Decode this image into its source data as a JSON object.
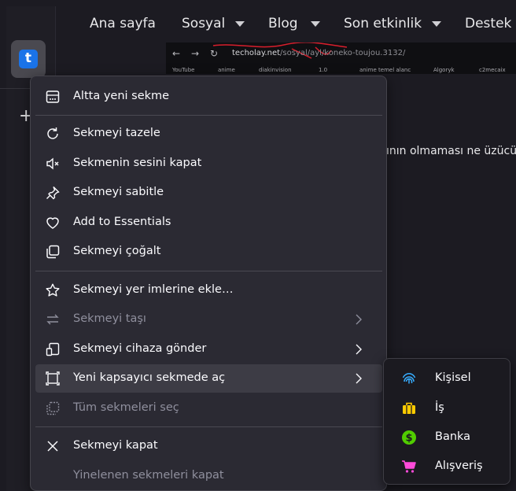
{
  "site_nav": {
    "items": [
      {
        "label": "Ana sayfa"
      },
      {
        "label": "Sosyal"
      },
      {
        "label": "Blog"
      },
      {
        "label": "Son etkinlik"
      },
      {
        "label": "Destek"
      }
    ]
  },
  "embedded_shot": {
    "url_host": "techolay.net",
    "url_path": "/sosyal/ayl/koneko-toujou.3132/",
    "bookmarks": [
      "YouTube",
      "anime",
      "diakinvision",
      "1.0",
      "anime temel alanc",
      "Algoryk",
      "c2mecaix"
    ]
  },
  "page_text": "ının olmaması ne üzücü.",
  "sidebar": {
    "tab_icon_letter": "t",
    "new_tab_glyph": "+"
  },
  "context_menu": {
    "items": [
      {
        "label": "Altta yeni sekme",
        "icon": "new-tab-below-icon",
        "disabled": false
      },
      {
        "label": "Sekmeyi tazele",
        "icon": "reload-icon",
        "disabled": false
      },
      {
        "label": "Sekmenin sesini kapat",
        "icon": "mute-icon",
        "disabled": false
      },
      {
        "label": "Sekmeyi sabitle",
        "icon": "pin-icon",
        "disabled": false
      },
      {
        "label": "Add to Essentials",
        "icon": "heart-icon",
        "disabled": false
      },
      {
        "label": "Sekmeyi çoğalt",
        "icon": "duplicate-icon",
        "disabled": false
      },
      {
        "label": "Sekmeyi yer imlerine ekle…",
        "icon": "star-icon",
        "disabled": false
      },
      {
        "label": "Sekmeyi taşı",
        "icon": "move-icon",
        "disabled": true,
        "submenu": true
      },
      {
        "label": "Sekmeyi cihaza gönder",
        "icon": "send-to-device-icon",
        "disabled": false,
        "submenu": true
      },
      {
        "label": "Yeni kapsayıcı sekmede aç",
        "icon": "container-icon",
        "disabled": false,
        "submenu": true,
        "highlighted": true
      },
      {
        "label": "Tüm sekmeleri seç",
        "icon": "select-all-icon",
        "disabled": true
      },
      {
        "label": "Sekmeyi kapat",
        "icon": "close-icon",
        "disabled": false
      },
      {
        "label": "Yinelenen sekmeleri kapat",
        "icon": "",
        "disabled": true
      }
    ]
  },
  "container_submenu": {
    "items": [
      {
        "label": "Kişisel",
        "icon": "fingerprint-icon",
        "color": "#37adff"
      },
      {
        "label": "İş",
        "icon": "briefcase-icon",
        "color": "#ffcb00"
      },
      {
        "label": "Banka",
        "icon": "dollar-icon",
        "color": "#51cd00"
      },
      {
        "label": "Alışveriş",
        "icon": "cart-icon",
        "color": "#ff4bda"
      }
    ]
  }
}
